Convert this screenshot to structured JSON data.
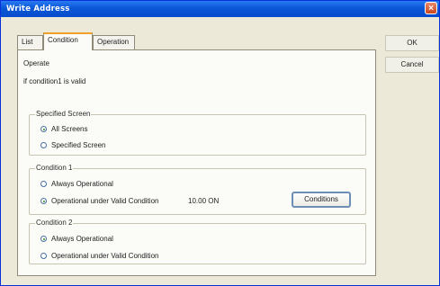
{
  "window": {
    "title": "Write Address"
  },
  "tabs": [
    {
      "label": "List",
      "active": false
    },
    {
      "label": "Condition",
      "active": true
    },
    {
      "label": "Operation",
      "active": false
    }
  ],
  "side_buttons": {
    "ok": "OK",
    "cancel": "Cancel"
  },
  "panel": {
    "operate_label": "Operate",
    "operate_text": "if condition1 is valid",
    "specified_screen": {
      "title": "Specified Screen",
      "options": [
        "All Screens",
        "Specified Screen"
      ],
      "selected": "All Screens"
    },
    "condition1": {
      "title": "Condition 1",
      "options": [
        "Always Operational",
        "Operational under Valid Condition"
      ],
      "selected": "Operational under Valid Condition",
      "value": "10.00 ON",
      "button": "Conditions"
    },
    "condition2": {
      "title": "Condition 2",
      "options": [
        "Always Operational",
        "Operational under Valid Condition"
      ],
      "selected": "Always Operational"
    }
  },
  "colors": {
    "titlebar": "#0a57d8",
    "close": "#c9461e",
    "active_tab_accent": "#f1a02a",
    "radio_on": "#2c8a1e"
  }
}
